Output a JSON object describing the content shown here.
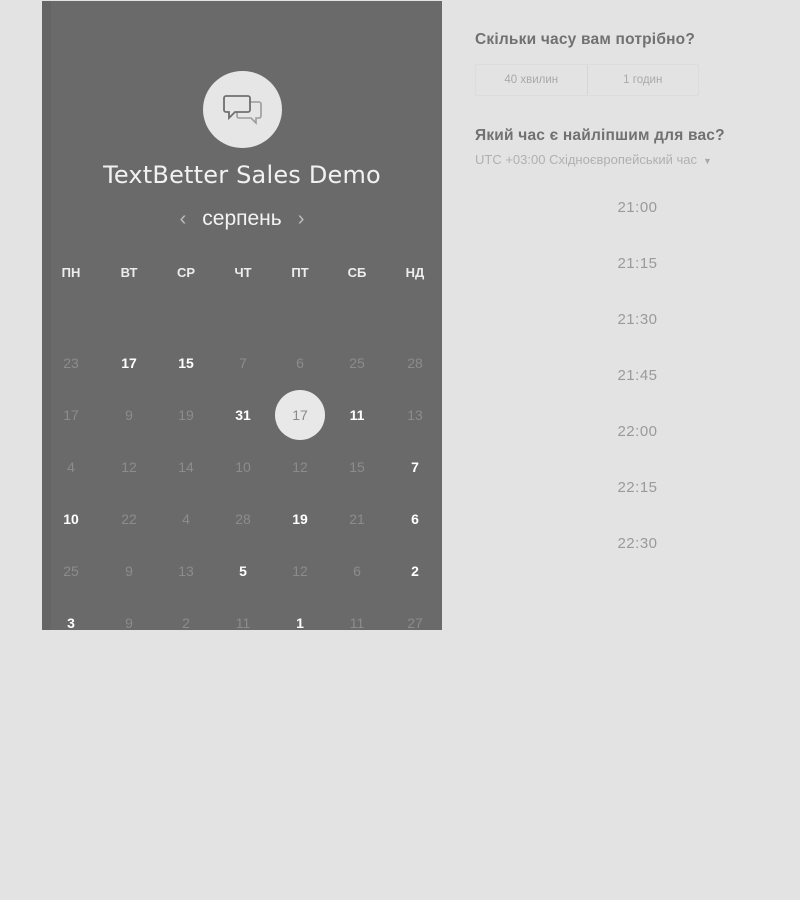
{
  "brand": {
    "title": "TextBetter Sales Demo",
    "logo_icon": "chat-bubbles-icon"
  },
  "calendar": {
    "month": "серпень",
    "prev_icon": "chevron-left-icon",
    "next_icon": "chevron-right-icon",
    "weekdays": [
      "ПН",
      "ВТ",
      "СР",
      "ЧТ",
      "ПТ",
      "СБ",
      "НД"
    ],
    "weeks": [
      [
        {
          "d": "23",
          "s": "dim"
        },
        {
          "d": "17",
          "s": "avail"
        },
        {
          "d": "15",
          "s": "avail"
        },
        {
          "d": "7",
          "s": "dim"
        },
        {
          "d": "6",
          "s": "dim"
        },
        {
          "d": "25",
          "s": "dim"
        },
        {
          "d": "28",
          "s": "dim"
        }
      ],
      [
        {
          "d": "17",
          "s": "dim"
        },
        {
          "d": "9",
          "s": "dim"
        },
        {
          "d": "19",
          "s": "dim"
        },
        {
          "d": "31",
          "s": "avail"
        },
        {
          "d": "17",
          "s": "selected"
        },
        {
          "d": "11",
          "s": "avail"
        },
        {
          "d": "13",
          "s": "dim"
        }
      ],
      [
        {
          "d": "4",
          "s": "dim"
        },
        {
          "d": "12",
          "s": "dim"
        },
        {
          "d": "14",
          "s": "dim"
        },
        {
          "d": "10",
          "s": "dim"
        },
        {
          "d": "12",
          "s": "dim"
        },
        {
          "d": "15",
          "s": "dim"
        },
        {
          "d": "7",
          "s": "avail"
        }
      ],
      [
        {
          "d": "10",
          "s": "avail"
        },
        {
          "d": "22",
          "s": "dim"
        },
        {
          "d": "4",
          "s": "dim"
        },
        {
          "d": "28",
          "s": "dim"
        },
        {
          "d": "19",
          "s": "avail"
        },
        {
          "d": "21",
          "s": "dim"
        },
        {
          "d": "6",
          "s": "avail"
        }
      ],
      [
        {
          "d": "25",
          "s": "dim"
        },
        {
          "d": "9",
          "s": "dim"
        },
        {
          "d": "13",
          "s": "dim"
        },
        {
          "d": "5",
          "s": "avail"
        },
        {
          "d": "12",
          "s": "dim"
        },
        {
          "d": "6",
          "s": "dim"
        },
        {
          "d": "2",
          "s": "avail"
        }
      ],
      [
        {
          "d": "3",
          "s": "avail"
        },
        {
          "d": "9",
          "s": "dim"
        },
        {
          "d": "2",
          "s": "dim"
        },
        {
          "d": "11",
          "s": "dim"
        },
        {
          "d": "1",
          "s": "avail"
        },
        {
          "d": "11",
          "s": "dim"
        },
        {
          "d": "27",
          "s": "dim"
        }
      ]
    ]
  },
  "duration": {
    "question": "Скільки часу вам потрібно?",
    "options": [
      "40 хвилин",
      "1 годин"
    ]
  },
  "time": {
    "question": "Який час є найліпшим для вас?",
    "timezone": "UTC +03:00 Східноєвропейський час",
    "slots": [
      "21:00",
      "21:15",
      "21:30",
      "21:45",
      "22:00",
      "22:15",
      "22:30"
    ]
  },
  "colors": {
    "panel": "#6a6a6a",
    "page": "#e3e3e3"
  }
}
